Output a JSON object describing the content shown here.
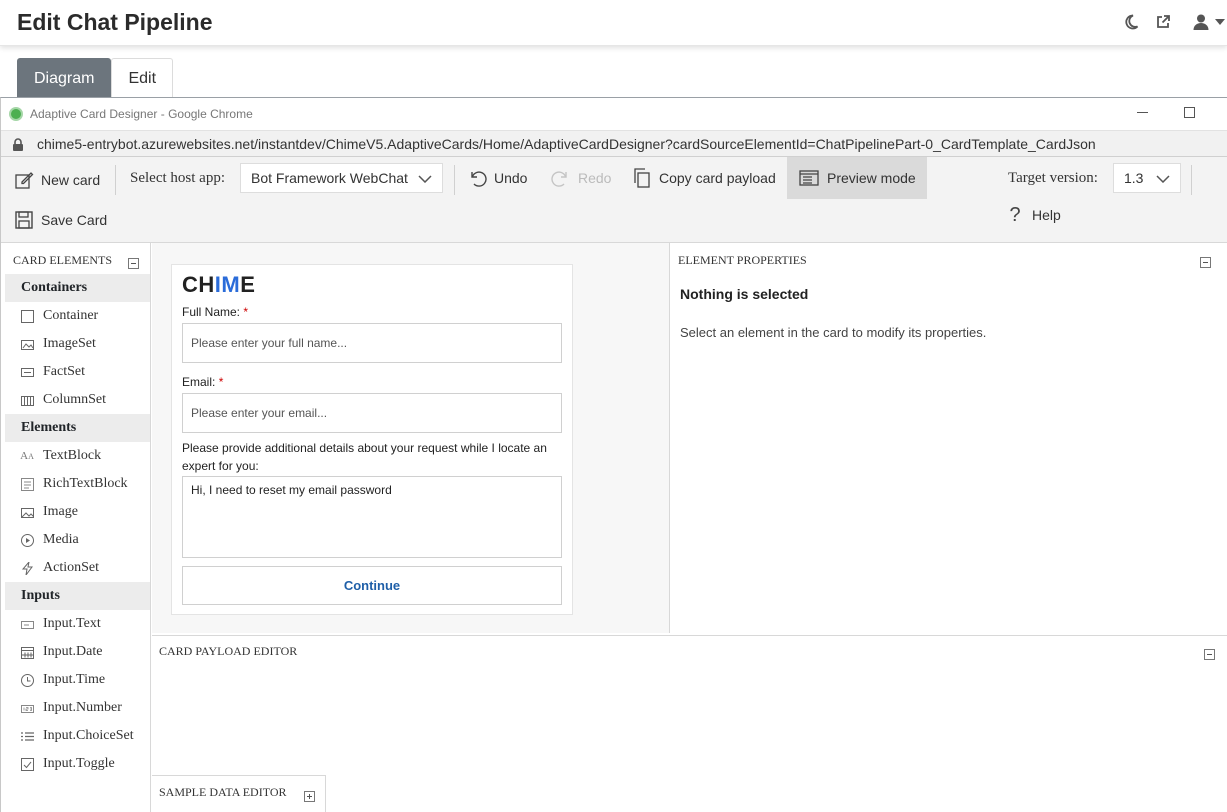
{
  "header": {
    "title": "Edit Chat Pipeline",
    "icons": [
      "moon-icon",
      "external-link-icon",
      "user-icon",
      "caret-down-icon"
    ]
  },
  "tabs": [
    {
      "label": "Diagram",
      "active": true
    },
    {
      "label": "Edit",
      "active": false
    }
  ],
  "browser": {
    "title": "Adaptive Card Designer - Google Chrome",
    "url": "chime5-entrybot.azurewebsites.net/instantdev/ChimeV5.AdaptiveCards/Home/AdaptiveCardDesigner?cardSourceElementId=ChatPipelinePart-0_CardTemplate_CardJson"
  },
  "toolbar": {
    "new_card": "New card",
    "host_label": "Select host app:",
    "host_value": "Bot Framework WebChat",
    "undo": "Undo",
    "redo": "Redo",
    "copy_payload": "Copy card payload",
    "preview_mode": "Preview mode",
    "target_label": "Target version:",
    "target_value": "1.3",
    "help": "Help",
    "save_card": "Save Card"
  },
  "card_elements": {
    "title": "CARD ELEMENTS",
    "categories": [
      {
        "name": "Containers",
        "items": [
          "Container",
          "ImageSet",
          "FactSet",
          "ColumnSet"
        ]
      },
      {
        "name": "Elements",
        "items": [
          "TextBlock",
          "RichTextBlock",
          "Image",
          "Media",
          "ActionSet"
        ]
      },
      {
        "name": "Inputs",
        "items": [
          "Input.Text",
          "Input.Date",
          "Input.Time",
          "Input.Number",
          "Input.ChoiceSet",
          "Input.Toggle"
        ]
      }
    ]
  },
  "card": {
    "logo_text": "CHIME",
    "full_name_label": "Full Name:",
    "full_name_placeholder": "Please enter your full name...",
    "email_label": "Email:",
    "email_placeholder": "Please enter your email...",
    "required_mark": "*",
    "details_label": "Please provide additional details about your request while I locate an expert for you:",
    "details_value": "Hi, I need to reset my email password",
    "continue": "Continue"
  },
  "properties": {
    "title": "ELEMENT PROPERTIES",
    "nothing": "Nothing is selected",
    "hint": "Select an element in the card to modify its properties."
  },
  "payload_editor": {
    "title": "CARD PAYLOAD EDITOR"
  },
  "sample_editor": {
    "title": "SAMPLE DATA EDITOR"
  }
}
